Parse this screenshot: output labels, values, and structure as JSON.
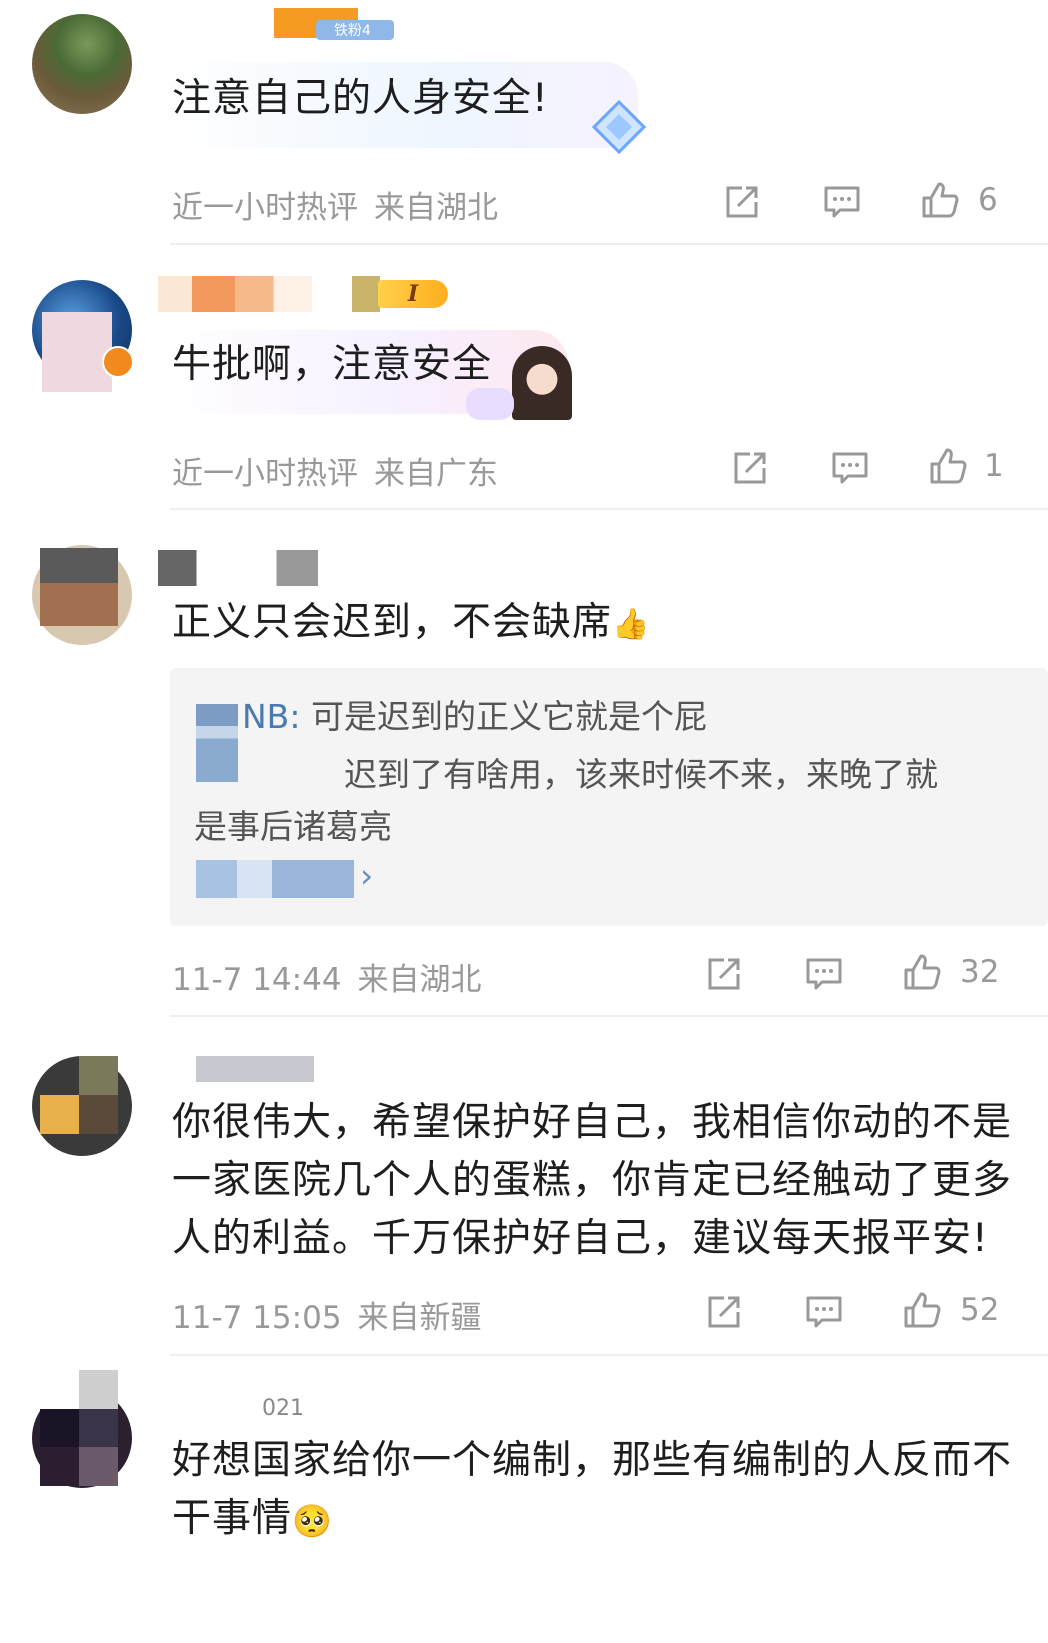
{
  "comments": [
    {
      "text": "注意自己的人身安全!",
      "time": "近一小时热评",
      "location": "来自湖北",
      "likes": "6"
    },
    {
      "text": "牛批啊，注意安全",
      "time": "近一小时热评",
      "location": "来自广东",
      "likes": "1"
    },
    {
      "text": "正义只会迟到，不会缺席",
      "time": "11-7 14:44",
      "location": "来自湖北",
      "likes": "32",
      "reply": {
        "name_fragment": "NB:",
        "line1": "可是迟到的正义它就是个屁",
        "line2": "迟到了有啥用，该来时候不来，来晚了就",
        "line3": "是事后诸葛亮",
        "chevron": "›"
      }
    },
    {
      "line1": "你很伟大，希望保护好自己，我相信你动的不是",
      "line2": "一家医院几个人的蛋糕，你肯定已经触动了更多",
      "line3": "人的利益。千万保护好自己，建议每天报平安!",
      "time": "11-7 15:05",
      "location": "来自新疆",
      "likes": "52"
    },
    {
      "line1": "好想国家给你一个编制，那些有编制的人反而不",
      "line2": "干事情",
      "name_fragment": "021"
    }
  ],
  "badges": {
    "level_badge": "I",
    "top_badge": "铁粉4"
  },
  "icons": {
    "share": "share-icon",
    "comment": "comment-icon",
    "like": "thumbs-up-icon"
  },
  "colors": {
    "meta": "#999999",
    "accent_orange": "#f0891e",
    "divider": "#efefef",
    "quote_bg": "#f4f4f4"
  }
}
